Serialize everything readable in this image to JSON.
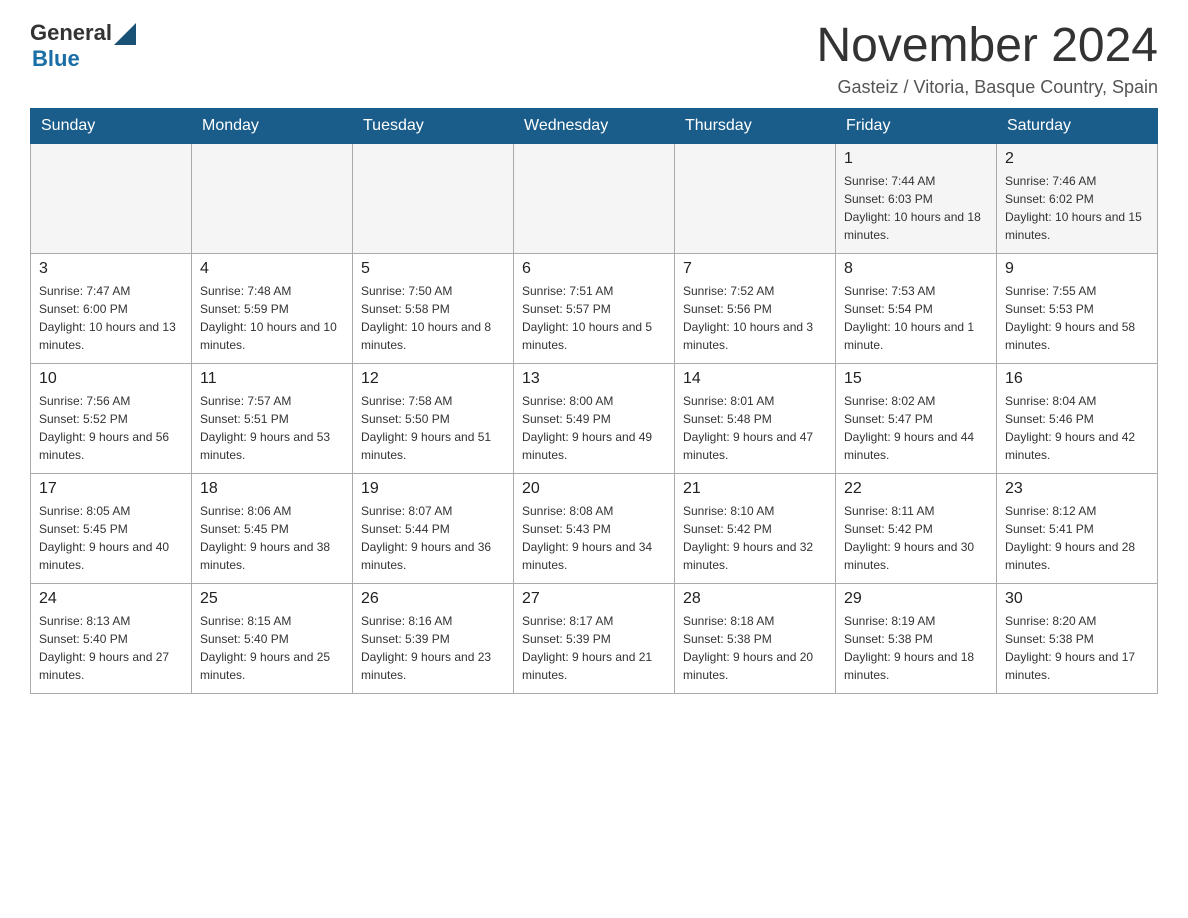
{
  "header": {
    "logo": {
      "general": "General",
      "blue": "Blue"
    },
    "title": "November 2024",
    "location": "Gasteiz / Vitoria, Basque Country, Spain"
  },
  "calendar": {
    "weekdays": [
      "Sunday",
      "Monday",
      "Tuesday",
      "Wednesday",
      "Thursday",
      "Friday",
      "Saturday"
    ],
    "weeks": [
      [
        {
          "day": "",
          "info": ""
        },
        {
          "day": "",
          "info": ""
        },
        {
          "day": "",
          "info": ""
        },
        {
          "day": "",
          "info": ""
        },
        {
          "day": "",
          "info": ""
        },
        {
          "day": "1",
          "info": "Sunrise: 7:44 AM\nSunset: 6:03 PM\nDaylight: 10 hours and 18 minutes."
        },
        {
          "day": "2",
          "info": "Sunrise: 7:46 AM\nSunset: 6:02 PM\nDaylight: 10 hours and 15 minutes."
        }
      ],
      [
        {
          "day": "3",
          "info": "Sunrise: 7:47 AM\nSunset: 6:00 PM\nDaylight: 10 hours and 13 minutes."
        },
        {
          "day": "4",
          "info": "Sunrise: 7:48 AM\nSunset: 5:59 PM\nDaylight: 10 hours and 10 minutes."
        },
        {
          "day": "5",
          "info": "Sunrise: 7:50 AM\nSunset: 5:58 PM\nDaylight: 10 hours and 8 minutes."
        },
        {
          "day": "6",
          "info": "Sunrise: 7:51 AM\nSunset: 5:57 PM\nDaylight: 10 hours and 5 minutes."
        },
        {
          "day": "7",
          "info": "Sunrise: 7:52 AM\nSunset: 5:56 PM\nDaylight: 10 hours and 3 minutes."
        },
        {
          "day": "8",
          "info": "Sunrise: 7:53 AM\nSunset: 5:54 PM\nDaylight: 10 hours and 1 minute."
        },
        {
          "day": "9",
          "info": "Sunrise: 7:55 AM\nSunset: 5:53 PM\nDaylight: 9 hours and 58 minutes."
        }
      ],
      [
        {
          "day": "10",
          "info": "Sunrise: 7:56 AM\nSunset: 5:52 PM\nDaylight: 9 hours and 56 minutes."
        },
        {
          "day": "11",
          "info": "Sunrise: 7:57 AM\nSunset: 5:51 PM\nDaylight: 9 hours and 53 minutes."
        },
        {
          "day": "12",
          "info": "Sunrise: 7:58 AM\nSunset: 5:50 PM\nDaylight: 9 hours and 51 minutes."
        },
        {
          "day": "13",
          "info": "Sunrise: 8:00 AM\nSunset: 5:49 PM\nDaylight: 9 hours and 49 minutes."
        },
        {
          "day": "14",
          "info": "Sunrise: 8:01 AM\nSunset: 5:48 PM\nDaylight: 9 hours and 47 minutes."
        },
        {
          "day": "15",
          "info": "Sunrise: 8:02 AM\nSunset: 5:47 PM\nDaylight: 9 hours and 44 minutes."
        },
        {
          "day": "16",
          "info": "Sunrise: 8:04 AM\nSunset: 5:46 PM\nDaylight: 9 hours and 42 minutes."
        }
      ],
      [
        {
          "day": "17",
          "info": "Sunrise: 8:05 AM\nSunset: 5:45 PM\nDaylight: 9 hours and 40 minutes."
        },
        {
          "day": "18",
          "info": "Sunrise: 8:06 AM\nSunset: 5:45 PM\nDaylight: 9 hours and 38 minutes."
        },
        {
          "day": "19",
          "info": "Sunrise: 8:07 AM\nSunset: 5:44 PM\nDaylight: 9 hours and 36 minutes."
        },
        {
          "day": "20",
          "info": "Sunrise: 8:08 AM\nSunset: 5:43 PM\nDaylight: 9 hours and 34 minutes."
        },
        {
          "day": "21",
          "info": "Sunrise: 8:10 AM\nSunset: 5:42 PM\nDaylight: 9 hours and 32 minutes."
        },
        {
          "day": "22",
          "info": "Sunrise: 8:11 AM\nSunset: 5:42 PM\nDaylight: 9 hours and 30 minutes."
        },
        {
          "day": "23",
          "info": "Sunrise: 8:12 AM\nSunset: 5:41 PM\nDaylight: 9 hours and 28 minutes."
        }
      ],
      [
        {
          "day": "24",
          "info": "Sunrise: 8:13 AM\nSunset: 5:40 PM\nDaylight: 9 hours and 27 minutes."
        },
        {
          "day": "25",
          "info": "Sunrise: 8:15 AM\nSunset: 5:40 PM\nDaylight: 9 hours and 25 minutes."
        },
        {
          "day": "26",
          "info": "Sunrise: 8:16 AM\nSunset: 5:39 PM\nDaylight: 9 hours and 23 minutes."
        },
        {
          "day": "27",
          "info": "Sunrise: 8:17 AM\nSunset: 5:39 PM\nDaylight: 9 hours and 21 minutes."
        },
        {
          "day": "28",
          "info": "Sunrise: 8:18 AM\nSunset: 5:38 PM\nDaylight: 9 hours and 20 minutes."
        },
        {
          "day": "29",
          "info": "Sunrise: 8:19 AM\nSunset: 5:38 PM\nDaylight: 9 hours and 18 minutes."
        },
        {
          "day": "30",
          "info": "Sunrise: 8:20 AM\nSunset: 5:38 PM\nDaylight: 9 hours and 17 minutes."
        }
      ]
    ]
  }
}
